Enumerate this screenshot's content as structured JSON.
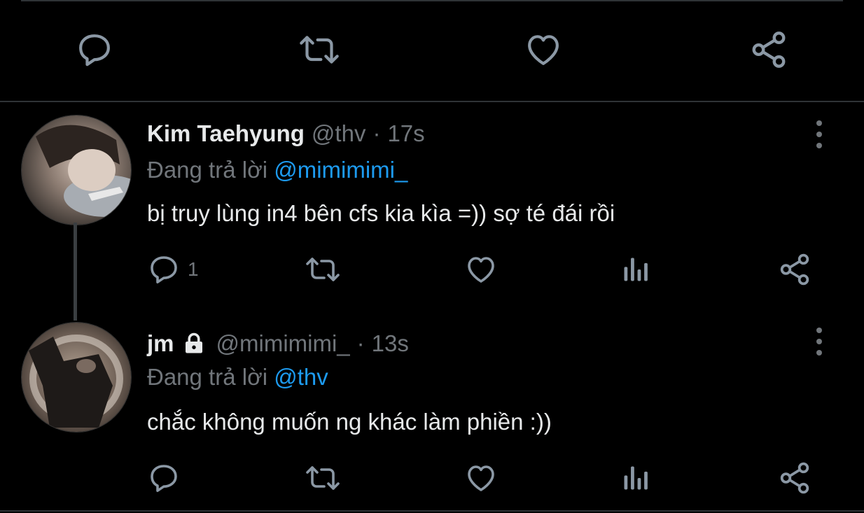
{
  "tweets": [
    {
      "name": "Kim Taehyung",
      "handle": "@thv",
      "separator": "·",
      "time": "17s",
      "reply_prefix": "Đang trả lời",
      "reply_to": "@mimimimi_",
      "text": "bị truy lùng in4 bên cfs kia kìa =)) sợ té đái rồi",
      "reply_count": "1"
    },
    {
      "name": "jm",
      "protected": true,
      "handle": "@mimimimi_",
      "separator": "·",
      "time": "13s",
      "reply_prefix": "Đang trả lời",
      "reply_to": "@thv",
      "text": "chắc không muốn ng khác làm phiền :))",
      "reply_count": ""
    }
  ],
  "icons": {
    "reply": "reply-icon",
    "retweet": "retweet-icon",
    "like": "like-icon",
    "analytics": "analytics-icon",
    "share": "share-icon",
    "more": "more-icon",
    "lock": "lock-icon"
  },
  "colors": {
    "background": "#000000",
    "text": "#e7e9ea",
    "muted": "#71767b",
    "mention": "#1d9bf0",
    "divider": "#2f3336"
  }
}
